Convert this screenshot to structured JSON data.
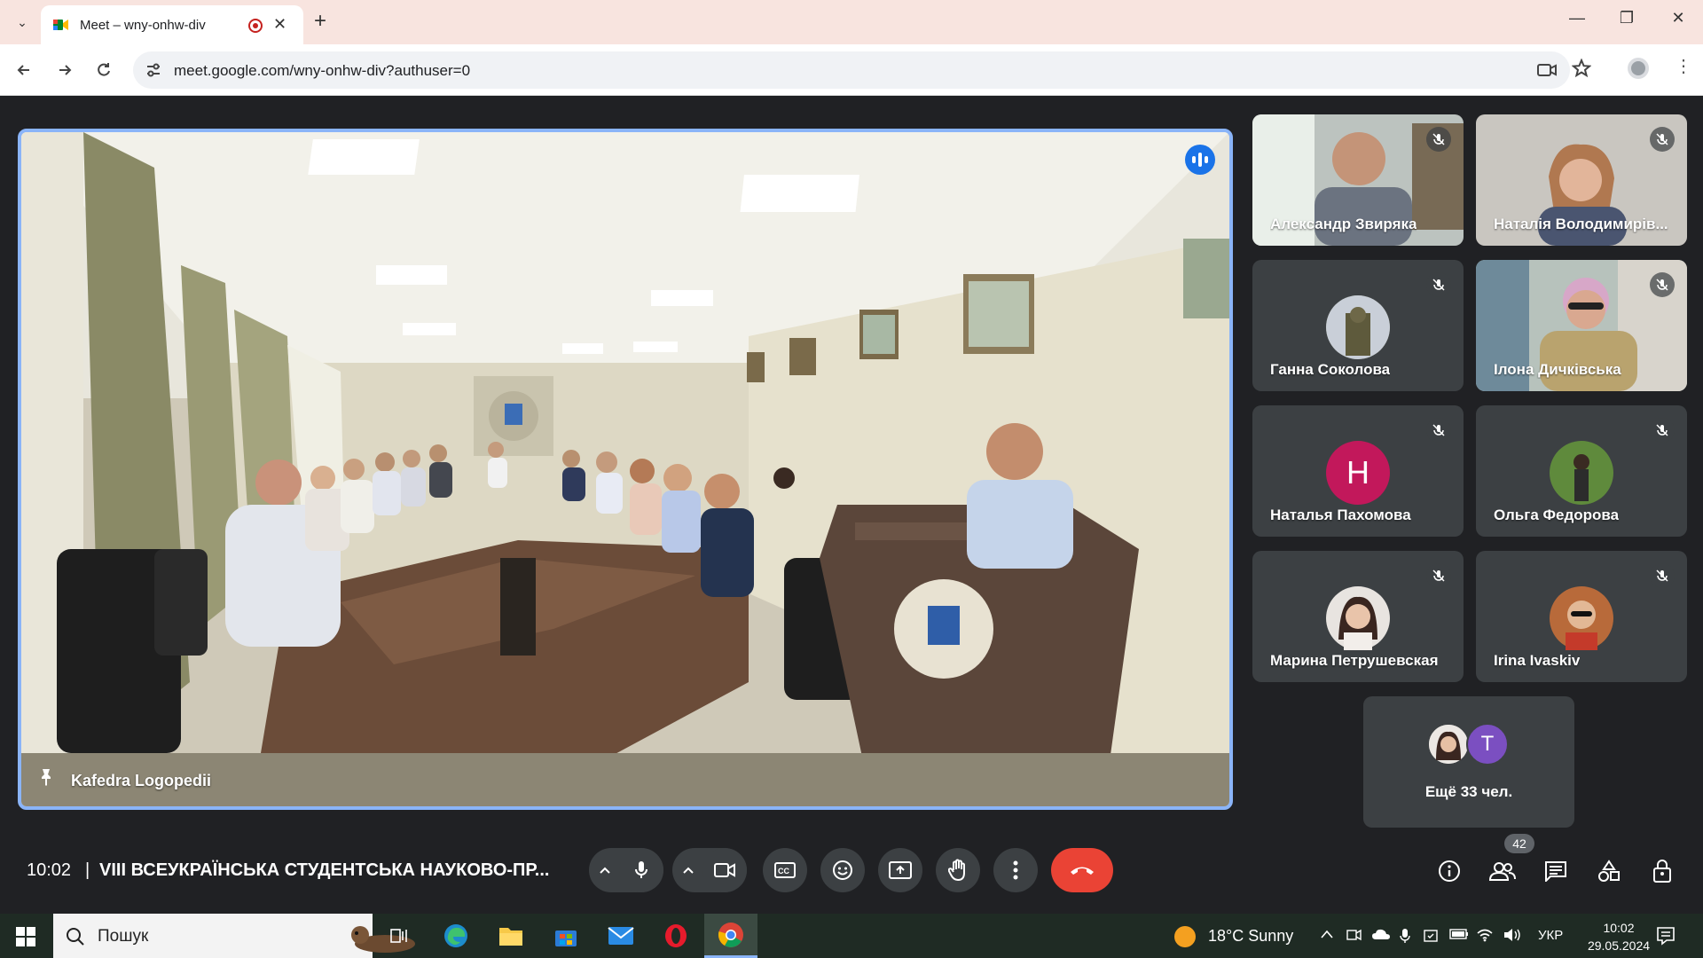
{
  "browser": {
    "tab_title": "Meet – wny-onhw-div",
    "url": "meet.google.com/wny-onhw-div?authuser=0"
  },
  "meeting": {
    "time": "10:02",
    "separator": "|",
    "title": "VIII ВСЕУКРАЇНСЬКА СТУДЕНТСЬКА НАУКОВО-ПР..."
  },
  "main_tile": {
    "name": "Kafedra Logopedii"
  },
  "participants": [
    {
      "name": "Александр Звиряка",
      "type": "video"
    },
    {
      "name": "Наталія Володимирів...",
      "type": "video"
    },
    {
      "name": "Ганна Соколова",
      "type": "avatar"
    },
    {
      "name": "Ілона Дичківська",
      "type": "video"
    },
    {
      "name": "Наталья Пахомова",
      "type": "letter",
      "initial": "Н",
      "color": "#c2185b"
    },
    {
      "name": "Ольга Федорова",
      "type": "avatar"
    },
    {
      "name": "Марина Петрушевская",
      "type": "avatar"
    },
    {
      "name": "Irina Ivaskiv",
      "type": "avatar"
    }
  ],
  "more": {
    "label": "Ещё 33 чел.",
    "initial": "Т"
  },
  "controls": {
    "participant_count": "42"
  },
  "taskbar": {
    "search_placeholder": "Пошук",
    "weather": "18°C  Sunny",
    "lang": "УКР",
    "time": "10:02",
    "date": "29.05.2024"
  },
  "colors": {
    "accent": "#8ab4f8",
    "end_call": "#ea4335",
    "tile_bg": "#3c4043",
    "page_bg": "#202124"
  }
}
